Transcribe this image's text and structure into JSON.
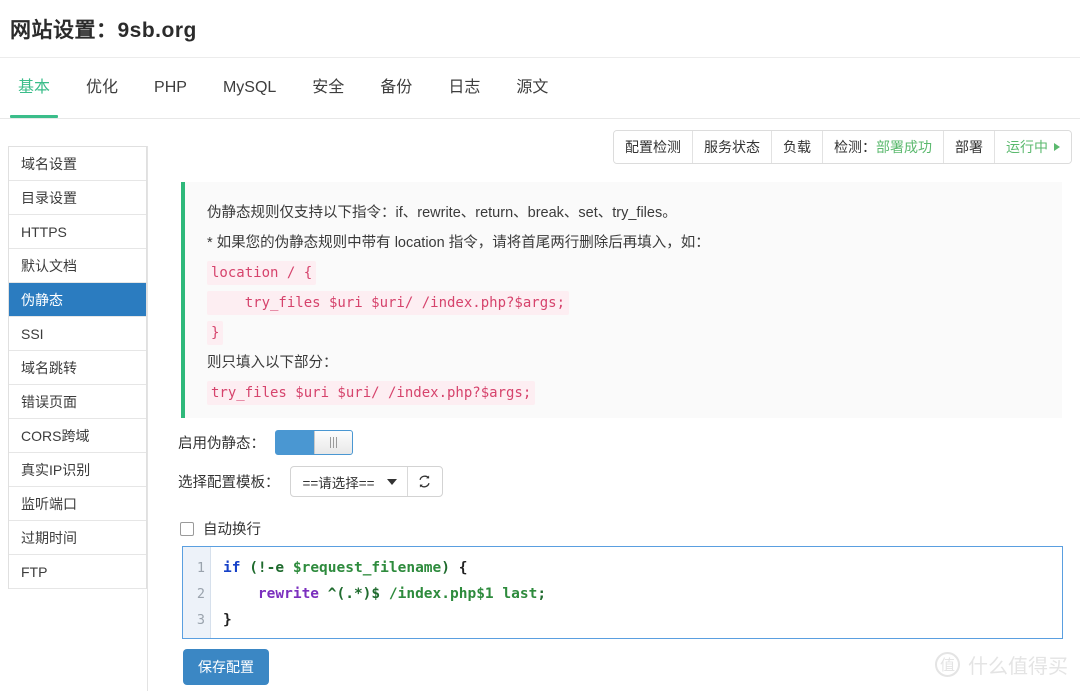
{
  "header": {
    "title": "网站设置：9sb.org"
  },
  "tabs": [
    {
      "label": "基本",
      "active": true
    },
    {
      "label": "优化",
      "active": false
    },
    {
      "label": "PHP",
      "active": false
    },
    {
      "label": "MySQL",
      "active": false
    },
    {
      "label": "安全",
      "active": false
    },
    {
      "label": "备份",
      "active": false
    },
    {
      "label": "日志",
      "active": false
    },
    {
      "label": "源文",
      "active": false
    }
  ],
  "toolbar": {
    "config_check": "配置检测",
    "service_status": "服务状态",
    "load": "负载",
    "detect_label": "检测：",
    "detect_value": "部署成功",
    "deploy": "部署",
    "running": "运行中"
  },
  "sidebar": {
    "items": [
      {
        "label": "域名设置",
        "active": false
      },
      {
        "label": "目录设置",
        "active": false
      },
      {
        "label": "HTTPS",
        "active": false
      },
      {
        "label": "默认文档",
        "active": false
      },
      {
        "label": "伪静态",
        "active": true
      },
      {
        "label": "SSI",
        "active": false
      },
      {
        "label": "域名跳转",
        "active": false
      },
      {
        "label": "错误页面",
        "active": false
      },
      {
        "label": "CORS跨域",
        "active": false
      },
      {
        "label": "真实IP识别",
        "active": false
      },
      {
        "label": "监听端口",
        "active": false
      },
      {
        "label": "过期时间",
        "active": false
      },
      {
        "label": "FTP",
        "active": false
      }
    ]
  },
  "info": {
    "line1": "伪静态规则仅支持以下指令：if、rewrite、return、break、set、try_files。",
    "line2": "* 如果您的伪静态规则中带有 location 指令，请将首尾两行删除后再填入，如：",
    "code1": "location / {",
    "code2": "    try_files $uri $uri/ /index.php?$args;",
    "code3": "}",
    "line3": "则只填入以下部分：",
    "code4": "try_files $uri $uri/ /index.php?$args;"
  },
  "controls": {
    "enable_label": "启用伪静态：",
    "enable_state": "on",
    "template_label": "选择配置模板：",
    "template_value": "==请选择==",
    "refresh_icon": "refresh-icon",
    "wrap_label": "自动换行",
    "wrap_checked": false
  },
  "editor": {
    "line_numbers": [
      "1",
      "2",
      "3"
    ],
    "lines": [
      [
        {
          "t": "if",
          "c": "kw"
        },
        {
          "t": " ",
          "c": "plain"
        },
        {
          "t": "(!-e ",
          "c": "pun"
        },
        {
          "t": "$request_filename",
          "c": "var"
        },
        {
          "t": ")",
          "c": "pun"
        },
        {
          "t": " ",
          "c": "plain"
        },
        {
          "t": "{",
          "c": "plain"
        }
      ],
      [
        {
          "t": "    ",
          "c": "plain"
        },
        {
          "t": "rewrite",
          "c": "fn"
        },
        {
          "t": " ",
          "c": "plain"
        },
        {
          "t": "^(.*)$",
          "c": "pun"
        },
        {
          "t": " ",
          "c": "plain"
        },
        {
          "t": "/index.php$1",
          "c": "var"
        },
        {
          "t": " ",
          "c": "plain"
        },
        {
          "t": "last",
          "c": "var"
        },
        {
          "t": ";",
          "c": "pun"
        }
      ],
      [
        {
          "t": "}",
          "c": "plain"
        }
      ]
    ]
  },
  "save_button": {
    "label": "保存配置"
  },
  "watermark": {
    "mark": "值",
    "text": "什么值得买"
  },
  "colors": {
    "accent_green": "#3bbd8a",
    "accent_blue": "#2b7cc0",
    "save_blue": "#3b87c4",
    "code_pink": "#d6436c",
    "status_green": "#5bb96e"
  }
}
